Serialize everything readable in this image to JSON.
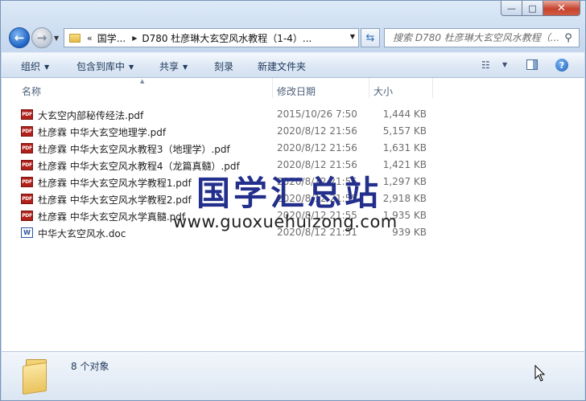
{
  "window": {
    "caption_buttons": {
      "minimize_glyph": "—",
      "maximize_glyph": "□",
      "close_glyph": "✕"
    }
  },
  "nav": {
    "back_glyph": "←",
    "forward_glyph": "→",
    "address": {
      "chevron": "«",
      "segments": [
        "国学...",
        "D780 杜彦琳大玄空风水教程（1-4）..."
      ]
    },
    "search_placeholder": "搜索 D780 杜彦琳大玄空风水教程（..."
  },
  "toolbar": {
    "organize": "组织",
    "include_in_library": "包含到库中",
    "share": "共享",
    "burn": "刻录",
    "new_folder": "新建文件夹"
  },
  "columns": {
    "name": "名称",
    "date": "修改日期",
    "size": "大小"
  },
  "files": [
    {
      "name": "大玄空内部秘传经法.pdf",
      "date": "2015/10/26 7:50",
      "size": "1,444 KB",
      "type": "pdf"
    },
    {
      "name": "杜彦霖 中华大玄空地理学.pdf",
      "date": "2020/8/12 21:56",
      "size": "5,157 KB",
      "type": "pdf"
    },
    {
      "name": "杜彦霖 中华大玄空风水教程3（地理学）.pdf",
      "date": "2020/8/12 21:56",
      "size": "1,631 KB",
      "type": "pdf"
    },
    {
      "name": "杜彦霖 中华大玄空风水教程4（龙篇真髓）.pdf",
      "date": "2020/8/12 21:56",
      "size": "1,421 KB",
      "type": "pdf"
    },
    {
      "name": "杜彦霖 中华大玄空风水学教程1.pdf",
      "date": "2020/8/12 21:55",
      "size": "1,297 KB",
      "type": "pdf"
    },
    {
      "name": "杜彦霖 中华大玄空风水学教程2.pdf",
      "date": "2020/8/12 21:55",
      "size": "2,918 KB",
      "type": "pdf"
    },
    {
      "name": "杜彦霖 中华大玄空风水学真髓.pdf",
      "date": "2020/8/12 21:55",
      "size": "1,935 KB",
      "type": "pdf"
    },
    {
      "name": "中华大玄空风水.doc",
      "date": "2020/8/12 21:51",
      "size": "939 KB",
      "type": "doc"
    }
  ],
  "watermark": {
    "cn": "国学汇总站",
    "url": "www.guoxuehuizong.com"
  },
  "status": {
    "count": "8 个对象"
  }
}
